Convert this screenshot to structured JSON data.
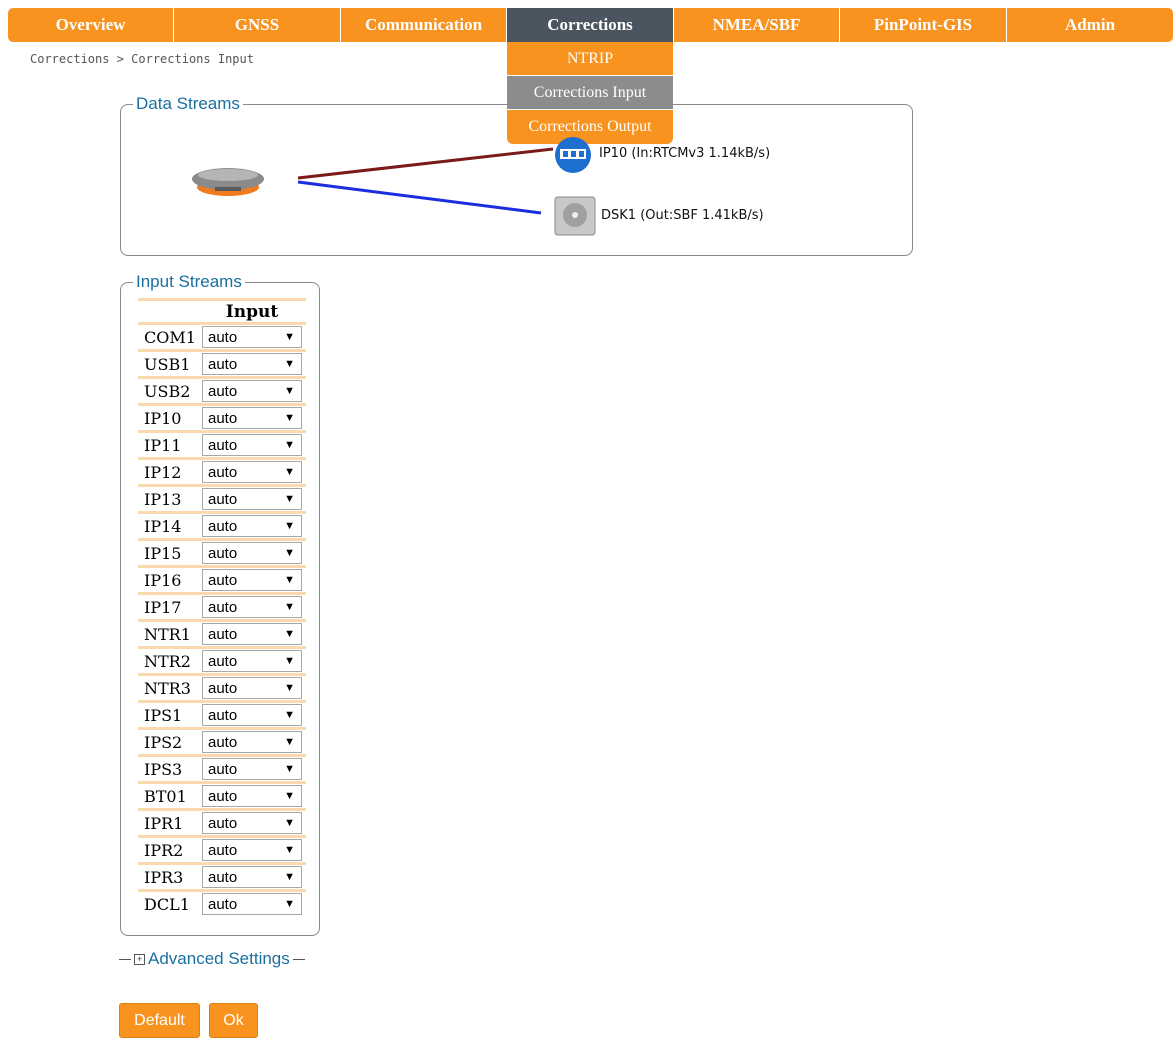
{
  "nav": {
    "tabs": [
      {
        "label": "Overview"
      },
      {
        "label": "GNSS"
      },
      {
        "label": "Communication"
      },
      {
        "label": "Corrections",
        "active": true
      },
      {
        "label": "NMEA/SBF"
      },
      {
        "label": "PinPoint-GIS"
      },
      {
        "label": "Admin"
      }
    ]
  },
  "dropdown": {
    "items": [
      {
        "label": "NTRIP"
      },
      {
        "label": "Corrections Input",
        "highlighted": true
      },
      {
        "label": "Corrections Output"
      }
    ]
  },
  "breadcrumb": "Corrections > Corrections Input",
  "data_streams": {
    "legend": "Data Streams",
    "ip_label": "IP10 (In:RTCMv3 1.14kB/s)",
    "disk_label": "DSK1 (Out:SBF 1.41kB/s)",
    "ip_line_color": "#7a1a1a",
    "disk_line_color": "#1a2ee0"
  },
  "input_streams": {
    "legend": "Input Streams",
    "column_header": "Input",
    "rows": [
      {
        "port": "COM1",
        "value": "auto"
      },
      {
        "port": "USB1",
        "value": "auto"
      },
      {
        "port": "USB2",
        "value": "auto"
      },
      {
        "port": "IP10",
        "value": "auto"
      },
      {
        "port": "IP11",
        "value": "auto"
      },
      {
        "port": "IP12",
        "value": "auto"
      },
      {
        "port": "IP13",
        "value": "auto"
      },
      {
        "port": "IP14",
        "value": "auto"
      },
      {
        "port": "IP15",
        "value": "auto"
      },
      {
        "port": "IP16",
        "value": "auto"
      },
      {
        "port": "IP17",
        "value": "auto"
      },
      {
        "port": "NTR1",
        "value": "auto"
      },
      {
        "port": "NTR2",
        "value": "auto"
      },
      {
        "port": "NTR3",
        "value": "auto"
      },
      {
        "port": "IPS1",
        "value": "auto"
      },
      {
        "port": "IPS2",
        "value": "auto"
      },
      {
        "port": "IPS3",
        "value": "auto"
      },
      {
        "port": "BT01",
        "value": "auto"
      },
      {
        "port": "IPR1",
        "value": "auto"
      },
      {
        "port": "IPR2",
        "value": "auto"
      },
      {
        "port": "IPR3",
        "value": "auto"
      },
      {
        "port": "DCL1",
        "value": "auto"
      }
    ]
  },
  "advanced": {
    "label": "Advanced Settings"
  },
  "buttons": {
    "default_label": "Default",
    "ok_label": "Ok"
  },
  "colors": {
    "accent": "#f7931e",
    "active_tab": "#4a5560",
    "legend_text": "#1a6fa0",
    "row_stripe": "#fbd9b0"
  }
}
